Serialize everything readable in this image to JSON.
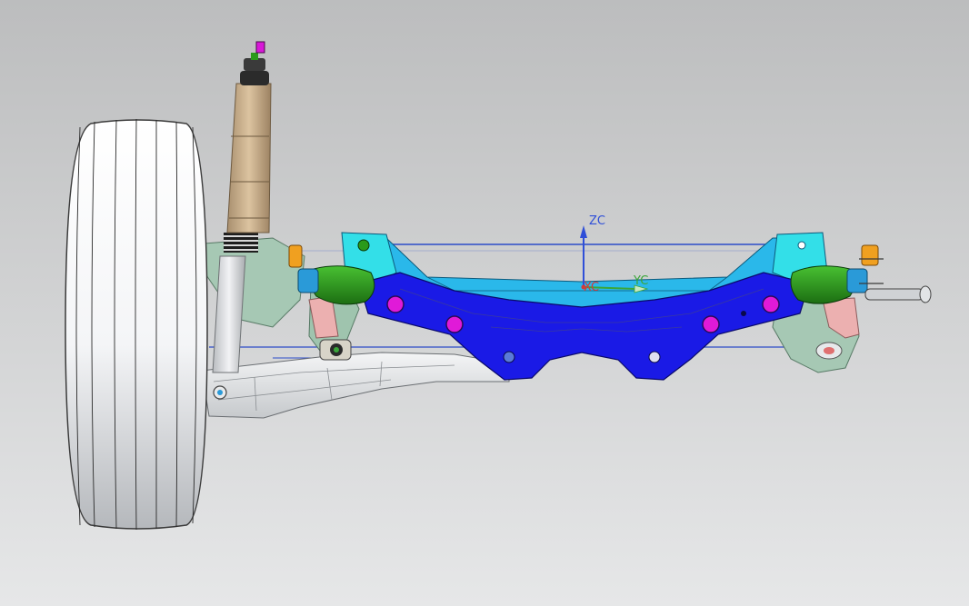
{
  "viewport": {
    "background_top": "#bcbdbe",
    "background_bottom": "#e6e7e8"
  },
  "wcs": {
    "zc_label": "ZC",
    "yc_label": "YC",
    "xc_label": "XC",
    "zc_color": "#2f4fd8",
    "yc_color": "#3aa63a",
    "xc_color": "#d23a3a"
  },
  "model": {
    "subframe_color": "#1a1ae6",
    "crossmember_color": "#2ab8ea",
    "tower_color": "#33dfe8",
    "bushing_color": "#2a9a1a",
    "mount_hole_color": "#e01ad8",
    "tire_color": "#f2f4f6",
    "shock_body_color": "#c7aa86",
    "control_arm_color": "#e4e6e8",
    "knuckle_color": "#a6c8b4",
    "wireframe_color": "#2c4cc8",
    "icon_names": [
      "tire-icon",
      "shock-absorber-icon",
      "subframe-icon",
      "control-arm-icon",
      "bushing-icon",
      "wcs-triad-icon"
    ]
  }
}
